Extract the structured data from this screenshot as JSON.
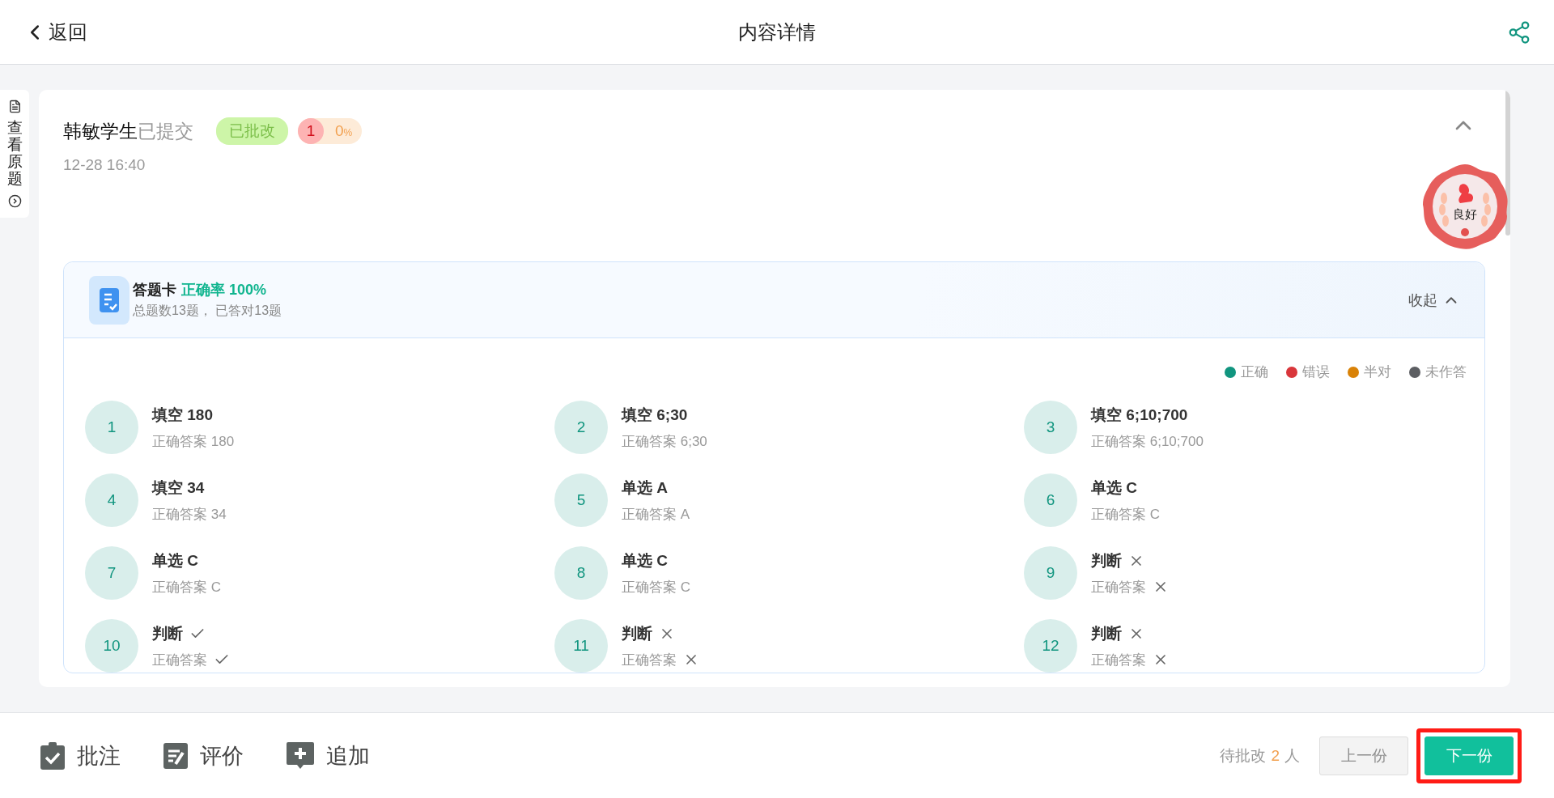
{
  "header": {
    "back_label": "返回",
    "title": "内容详情"
  },
  "side_tab": {
    "label": "查看原题"
  },
  "submission": {
    "student": "韩敏学生",
    "status_text": "已提交",
    "graded_label": "已批改",
    "score_count": "1",
    "score_value": "0",
    "score_unit": "%",
    "time": "12-28 16:40",
    "expanded": true,
    "grade": "良好"
  },
  "answer_card": {
    "title": "答题卡",
    "accuracy": "正确率 100%",
    "summary": "总题数13题， 已答对13题",
    "collapse_label": "收起",
    "expanded": true,
    "legend": [
      {
        "label": "正确",
        "color": "#11957f"
      },
      {
        "label": "错误",
        "color": "#d9363b"
      },
      {
        "label": "半对",
        "color": "#d98207"
      },
      {
        "label": "未作答",
        "color": "#5c5e62"
      }
    ],
    "items": [
      {
        "number": "1",
        "kind": "text",
        "type": "填空",
        "answer": "180",
        "correct_label": "正确答案",
        "correct_answer": "180",
        "color": "#11957f"
      },
      {
        "number": "2",
        "kind": "text",
        "type": "填空",
        "answer": "6;30",
        "correct_label": "正确答案",
        "correct_answer": "6;30",
        "color": "#11957f"
      },
      {
        "number": "3",
        "kind": "text",
        "type": "填空",
        "answer": "6;10;700",
        "correct_label": "正确答案",
        "correct_answer": "6;10;700",
        "color": "#11957f"
      },
      {
        "number": "4",
        "kind": "text",
        "type": "填空",
        "answer": "34",
        "correct_label": "正确答案",
        "correct_answer": "34",
        "color": "#11957f"
      },
      {
        "number": "5",
        "kind": "text",
        "type": "单选",
        "answer": "A",
        "correct_label": "正确答案",
        "correct_answer": "A",
        "color": "#11957f"
      },
      {
        "number": "6",
        "kind": "text",
        "type": "单选",
        "answer": "C",
        "correct_label": "正确答案",
        "correct_answer": "C",
        "color": "#11957f"
      },
      {
        "number": "7",
        "kind": "text",
        "type": "单选",
        "answer": "C",
        "correct_label": "正确答案",
        "correct_answer": "C",
        "color": "#11957f"
      },
      {
        "number": "8",
        "kind": "text",
        "type": "单选",
        "answer": "C",
        "correct_label": "正确答案",
        "correct_answer": "C",
        "color": "#11957f"
      },
      {
        "number": "9",
        "kind": "judge",
        "type": "判断",
        "answer_true": false,
        "correct_label": "正确答案",
        "correct_true": false,
        "color": "#11957f"
      },
      {
        "number": "10",
        "kind": "judge",
        "type": "判断",
        "answer_true": true,
        "correct_label": "正确答案",
        "correct_true": true,
        "color": "#11957f"
      },
      {
        "number": "11",
        "kind": "judge",
        "type": "判断",
        "answer_true": false,
        "correct_label": "正确答案",
        "correct_true": false,
        "color": "#11957f"
      },
      {
        "number": "12",
        "kind": "judge",
        "type": "判断",
        "answer_true": false,
        "correct_label": "正确答案",
        "correct_true": false,
        "color": "#11957f"
      }
    ]
  },
  "actions": [
    {
      "label": "批注",
      "kind": "annotate"
    },
    {
      "label": "评价",
      "kind": "review"
    },
    {
      "label": "追加",
      "kind": "add"
    }
  ],
  "pending": {
    "label": "待批改",
    "count": "2",
    "unit": "人"
  },
  "nav_buttons": [
    {
      "label": "上一份",
      "disabled": true,
      "primary": false,
      "highlighted": false
    },
    {
      "label": "下一份",
      "disabled": false,
      "primary": true,
      "highlighted": true
    }
  ]
}
